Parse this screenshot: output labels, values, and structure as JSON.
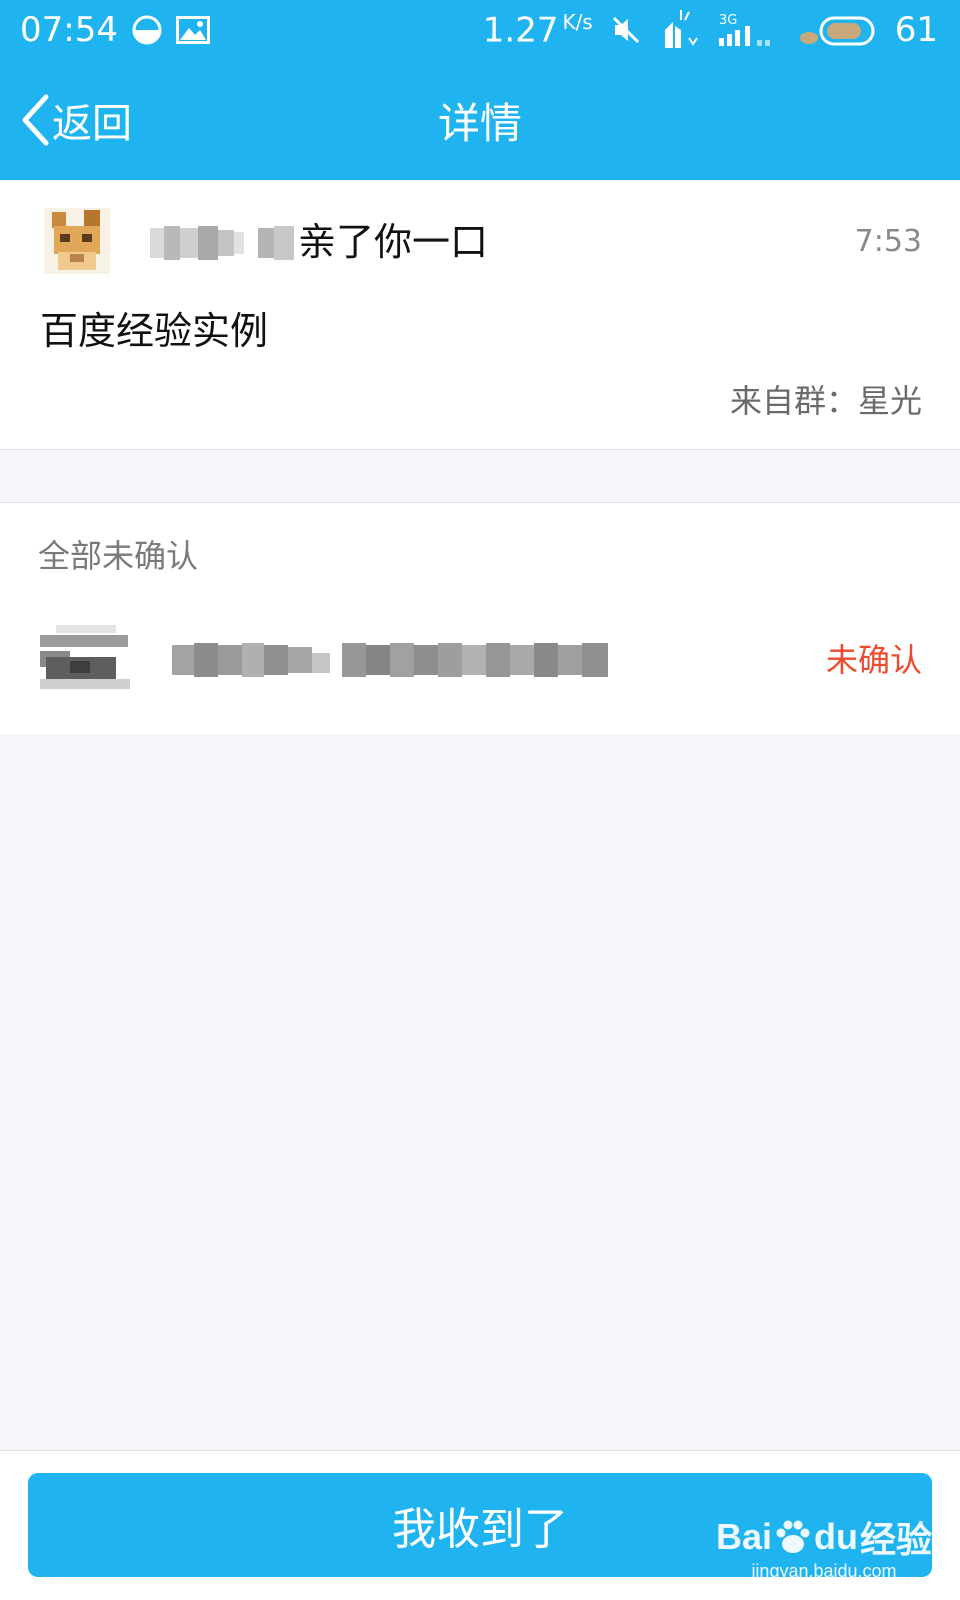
{
  "status_bar": {
    "time": "07:54",
    "net_speed": "1.27",
    "net_unit": "K/s",
    "signal_label": "3G",
    "battery": "61"
  },
  "nav": {
    "back_label": "返回",
    "title": "详情"
  },
  "message": {
    "action": "亲了你一口",
    "time": "7:53",
    "body": "百度经验实例",
    "source_prefix": "来自群：",
    "source_group": "星光"
  },
  "members": {
    "section_title": "全部未确认",
    "items": [
      {
        "status": "未确认"
      }
    ]
  },
  "footer": {
    "confirm_label": "我收到了"
  },
  "watermark": {
    "brand_bai": "Bai",
    "brand_du": "du",
    "brand_cn": "经验",
    "url": "jingyan.baidu.com"
  },
  "colors": {
    "primary": "#1fb4ef",
    "status_red": "#ee4a2d",
    "background": "#f5f6fa"
  }
}
